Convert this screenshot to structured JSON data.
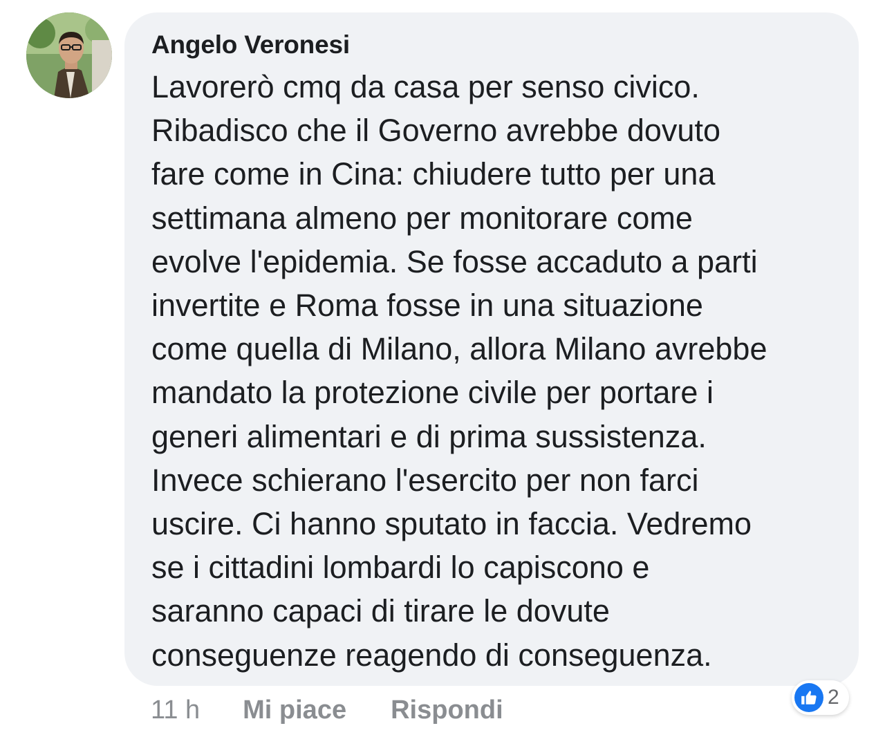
{
  "comment": {
    "author": "Angelo Veronesi",
    "lines": [
      "Lavorerò cmq da casa per senso civico.",
      "Ribadisco che il Governo avrebbe dovuto",
      "fare come in Cina: chiudere tutto per una",
      "settimana almeno per monitorare come",
      "evolve l'epidemia. Se fosse accaduto a parti",
      "invertite e Roma fosse in una situazione",
      "come quella di Milano, allora Milano avrebbe",
      "mandato la protezione civile per portare i",
      "generi alimentari e di prima sussistenza.",
      "Invece schierano l'esercito per non farci",
      "uscire. Ci hanno sputato in faccia. Vedremo",
      "se i cittadini lombardi lo capiscono e",
      "saranno capaci di tirare le dovute",
      "conseguenze reagendo di conseguenza."
    ]
  },
  "actions": {
    "time": "11 h",
    "like_label": "Mi piace",
    "reply_label": "Rispondi"
  },
  "reactions": {
    "icon": "thumbs-up-icon",
    "count": "2",
    "like_color": "#1877f2"
  },
  "colors": {
    "bubble": "#f0f2f5",
    "text": "#1c1e21",
    "meta": "#8a8d91"
  }
}
